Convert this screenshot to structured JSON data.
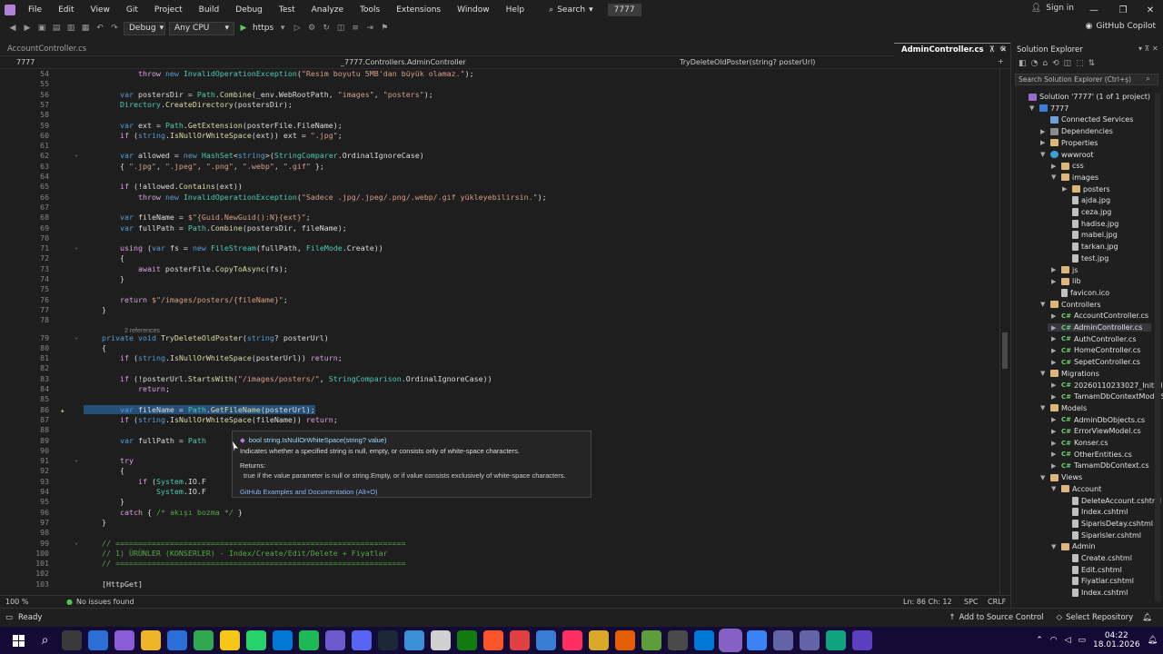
{
  "menu": {
    "items": [
      "File",
      "Edit",
      "View",
      "Git",
      "Project",
      "Build",
      "Debug",
      "Test",
      "Analyze",
      "Tools",
      "Extensions",
      "Window",
      "Help"
    ],
    "search_label": "Search",
    "solution_name": "7777",
    "sign_in": "Sign in"
  },
  "toolbar": {
    "config": "Debug",
    "platform": "Any CPU",
    "run_target": "https",
    "copilot": "GitHub Copilot"
  },
  "tabs": {
    "left": "AccountController.cs",
    "active": "AdminController.cs"
  },
  "navbar": {
    "project": "7777",
    "class_path": "_7777.Controllers.AdminController",
    "member": "TryDeleteOldPoster(string? posterUrl)"
  },
  "code": {
    "lines": [
      {
        "n": "54",
        "t": "            throw new InvalidOperationException(\"Resim boyutu 5MB'dan büyük olamaz.\");"
      },
      {
        "n": "55",
        "t": ""
      },
      {
        "n": "56",
        "t": "        var postersDir = Path.Combine(_env.WebRootPath, \"images\", \"posters\");"
      },
      {
        "n": "57",
        "t": "        Directory.CreateDirectory(postersDir);"
      },
      {
        "n": "58",
        "t": ""
      },
      {
        "n": "59",
        "t": "        var ext = Path.GetExtension(posterFile.FileName);"
      },
      {
        "n": "60",
        "t": "        if (string.IsNullOrWhiteSpace(ext)) ext = \".jpg\";"
      },
      {
        "n": "61",
        "t": ""
      },
      {
        "n": "62",
        "t": "        var allowed = new HashSet<string>(StringComparer.OrdinalIgnoreCase)"
      },
      {
        "n": "63",
        "t": "        { \".jpg\", \".jpeg\", \".png\", \".webp\", \".gif\" };"
      },
      {
        "n": "64",
        "t": ""
      },
      {
        "n": "65",
        "t": "        if (!allowed.Contains(ext))"
      },
      {
        "n": "66",
        "t": "            throw new InvalidOperationException(\"Sadece .jpg/.jpeg/.png/.webp/.gif yükleyebilirsin.\");"
      },
      {
        "n": "67",
        "t": ""
      },
      {
        "n": "68",
        "t": "        var fileName = $\"{Guid.NewGuid():N}{ext}\";"
      },
      {
        "n": "69",
        "t": "        var fullPath = Path.Combine(postersDir, fileName);"
      },
      {
        "n": "70",
        "t": ""
      },
      {
        "n": "71",
        "t": "        using (var fs = new FileStream(fullPath, FileMode.Create))"
      },
      {
        "n": "72",
        "t": "        {"
      },
      {
        "n": "73",
        "t": "            await posterFile.CopyToAsync(fs);"
      },
      {
        "n": "74",
        "t": "        }"
      },
      {
        "n": "75",
        "t": ""
      },
      {
        "n": "76",
        "t": "        return $\"/images/posters/{fileName}\";"
      },
      {
        "n": "77",
        "t": "    }"
      },
      {
        "n": "78",
        "t": ""
      },
      {
        "n": "79",
        "t": "    private void TryDeleteOldPoster(string? posterUrl)"
      },
      {
        "n": "80",
        "t": "    {"
      },
      {
        "n": "81",
        "t": "        if (string.IsNullOrWhiteSpace(posterUrl)) return;"
      },
      {
        "n": "82",
        "t": ""
      },
      {
        "n": "83",
        "t": "        if (!posterUrl.StartsWith(\"/images/posters/\", StringComparison.OrdinalIgnoreCase))"
      },
      {
        "n": "84",
        "t": "            return;"
      },
      {
        "n": "85",
        "t": ""
      },
      {
        "n": "86",
        "t": "        var fileName = Path.GetFileName(posterUrl);"
      },
      {
        "n": "87",
        "t": "        if (string.IsNullOrWhiteSpace(fileName)) return;"
      },
      {
        "n": "88",
        "t": ""
      },
      {
        "n": "89",
        "t": "        var fullPath = Path"
      },
      {
        "n": "90",
        "t": ""
      },
      {
        "n": "91",
        "t": "        try"
      },
      {
        "n": "92",
        "t": "        {"
      },
      {
        "n": "93",
        "t": "            if (System.IO.F"
      },
      {
        "n": "94",
        "t": "                System.IO.F"
      },
      {
        "n": "95",
        "t": "        }"
      },
      {
        "n": "96",
        "t": "        catch { /* akışı bozma */ }"
      },
      {
        "n": "97",
        "t": "    }"
      },
      {
        "n": "98",
        "t": ""
      },
      {
        "n": "99",
        "t": "    // ================================================================"
      },
      {
        "n": "100",
        "t": "    // 1) ÜRÜNLER (KONSERLER) - Index/Create/Edit/Delete + Fiyatlar"
      },
      {
        "n": "101",
        "t": "    // ================================================================"
      },
      {
        "n": "102",
        "t": ""
      },
      {
        "n": "103",
        "t": "    [HttpGet]"
      }
    ],
    "refs_label": "2 references"
  },
  "tooltip": {
    "signature": "bool string.IsNullOrWhiteSpace(string? value)",
    "description": "Indicates whether a specified string is null, empty, or consists only of white-space characters.",
    "returns_label": "Returns:",
    "returns_text": "true if the value parameter is null or string.Empty, or if value consists exclusively of white-space characters.",
    "link": "GitHub Examples and Documentation (Alt+O)"
  },
  "editor_status": {
    "zoom": "100 %",
    "issues": "No issues found",
    "position": "Ln: 86   Ch: 12",
    "spc": "SPC",
    "crlf": "CRLF"
  },
  "solution_explorer": {
    "title": "Solution Explorer",
    "search_placeholder": "Search Solution Explorer (Ctrl+ş)",
    "nodes": [
      {
        "label": "Solution '7777' (1 of 1 project)",
        "depth": 0,
        "kind": "sln",
        "arrow": ""
      },
      {
        "label": "7777",
        "depth": 1,
        "kind": "proj",
        "arrow": "▼"
      },
      {
        "label": "Connected Services",
        "depth": 2,
        "kind": "svc",
        "arrow": ""
      },
      {
        "label": "Dependencies",
        "depth": 2,
        "kind": "dep",
        "arrow": "▶"
      },
      {
        "label": "Properties",
        "depth": 2,
        "kind": "folder",
        "arrow": "▶"
      },
      {
        "label": "wwwroot",
        "depth": 2,
        "kind": "web",
        "arrow": "▼"
      },
      {
        "label": "css",
        "depth": 3,
        "kind": "folder",
        "arrow": "▶"
      },
      {
        "label": "images",
        "depth": 3,
        "kind": "folder",
        "arrow": "▼"
      },
      {
        "label": "posters",
        "depth": 4,
        "kind": "folder",
        "arrow": "▶"
      },
      {
        "label": "ajda.jpg",
        "depth": 4,
        "kind": "file",
        "arrow": ""
      },
      {
        "label": "ceza.jpg",
        "depth": 4,
        "kind": "file",
        "arrow": ""
      },
      {
        "label": "hadise.jpg",
        "depth": 4,
        "kind": "file",
        "arrow": ""
      },
      {
        "label": "mabel.jpg",
        "depth": 4,
        "kind": "file",
        "arrow": ""
      },
      {
        "label": "tarkan.jpg",
        "depth": 4,
        "kind": "file",
        "arrow": ""
      },
      {
        "label": "test.jpg",
        "depth": 4,
        "kind": "file",
        "arrow": ""
      },
      {
        "label": "js",
        "depth": 3,
        "kind": "folder",
        "arrow": "▶"
      },
      {
        "label": "lib",
        "depth": 3,
        "kind": "folder",
        "arrow": "▶"
      },
      {
        "label": "favicon.ico",
        "depth": 3,
        "kind": "file",
        "arrow": ""
      },
      {
        "label": "Controllers",
        "depth": 2,
        "kind": "folder",
        "arrow": "▼"
      },
      {
        "label": "AccountController.cs",
        "depth": 3,
        "kind": "cs",
        "arrow": "▶"
      },
      {
        "label": "AdminController.cs",
        "depth": 3,
        "kind": "cs",
        "arrow": "▶",
        "selected": true
      },
      {
        "label": "AuthController.cs",
        "depth": 3,
        "kind": "cs",
        "arrow": "▶"
      },
      {
        "label": "HomeController.cs",
        "depth": 3,
        "kind": "cs",
        "arrow": "▶"
      },
      {
        "label": "SepetController.cs",
        "depth": 3,
        "kind": "cs",
        "arrow": "▶"
      },
      {
        "label": "Migrations",
        "depth": 2,
        "kind": "folder",
        "arrow": "▼"
      },
      {
        "label": "20260110233027_InitialBas",
        "depth": 3,
        "kind": "cs",
        "arrow": "▶"
      },
      {
        "label": "TamamDbContextModelS",
        "depth": 3,
        "kind": "cs",
        "arrow": "▶"
      },
      {
        "label": "Models",
        "depth": 2,
        "kind": "folder",
        "arrow": "▼"
      },
      {
        "label": "AdminDbObjects.cs",
        "depth": 3,
        "kind": "cs",
        "arrow": "▶"
      },
      {
        "label": "ErrorViewModel.cs",
        "depth": 3,
        "kind": "cs",
        "arrow": "▶"
      },
      {
        "label": "Konser.cs",
        "depth": 3,
        "kind": "cs",
        "arrow": "▶"
      },
      {
        "label": "OtherEntities.cs",
        "depth": 3,
        "kind": "cs",
        "arrow": "▶"
      },
      {
        "label": "TamamDbContext.cs",
        "depth": 3,
        "kind": "cs",
        "arrow": "▶"
      },
      {
        "label": "Views",
        "depth": 2,
        "kind": "folder",
        "arrow": "▼"
      },
      {
        "label": "Account",
        "depth": 3,
        "kind": "folder",
        "arrow": "▼"
      },
      {
        "label": "DeleteAccount.cshtml",
        "depth": 4,
        "kind": "file",
        "arrow": ""
      },
      {
        "label": "Index.cshtml",
        "depth": 4,
        "kind": "file",
        "arrow": ""
      },
      {
        "label": "SiparisDetay.cshtml",
        "depth": 4,
        "kind": "file",
        "arrow": ""
      },
      {
        "label": "Siparisler.cshtml",
        "depth": 4,
        "kind": "file",
        "arrow": ""
      },
      {
        "label": "Admin",
        "depth": 3,
        "kind": "folder",
        "arrow": "▼"
      },
      {
        "label": "Create.cshtml",
        "depth": 4,
        "kind": "file",
        "arrow": ""
      },
      {
        "label": "Edit.cshtml",
        "depth": 4,
        "kind": "file",
        "arrow": ""
      },
      {
        "label": "Fiyatlar.cshtml",
        "depth": 4,
        "kind": "file",
        "arrow": ""
      },
      {
        "label": "Index.cshtml",
        "depth": 4,
        "kind": "file",
        "arrow": ""
      }
    ]
  },
  "statusbar": {
    "ready": "Ready",
    "source_control": "Add to Source Control",
    "repository": "Select Repository"
  },
  "taskbar": {
    "time": "04:22",
    "date": "18.01.2026",
    "icons": [
      "start-icon",
      "search-icon",
      "task-view-icon",
      "calculator-icon",
      "app-icon",
      "file-explorer-icon",
      "cloud-icon",
      "chrome-icon",
      "folder-icon",
      "whatsapp-icon",
      "outlook-icon",
      "spotify-icon",
      "app2-icon",
      "discord-icon",
      "steam-icon",
      "vpn-icon",
      "sql-icon",
      "xbox-icon",
      "brave-icon",
      "app3-icon",
      "app4-icon",
      "rider-icon",
      "app5-icon",
      "chat-icon",
      "minecraft-icon",
      "terminal-icon",
      "vscode-icon",
      "visual-studio-icon",
      "app6-icon",
      "app7-icon",
      "teams-icon",
      "chatgpt-icon",
      "app8-icon"
    ]
  },
  "colors": {
    "accent": "#b180d7",
    "selection": "#264f78",
    "taskbar": "#140a36"
  }
}
